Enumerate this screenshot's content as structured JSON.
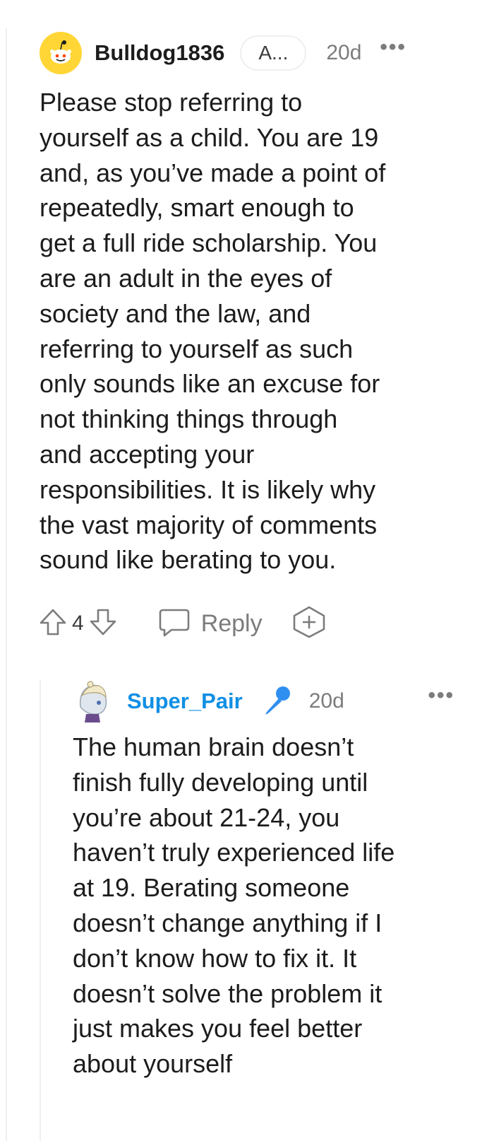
{
  "comment": {
    "author": "Bulldog1836",
    "flair": "A...",
    "age": "20d",
    "more": "•••",
    "body_lines": [
      "Please stop referring to",
      "yourself as a child. You are 19",
      "and, as you’ve made a point of",
      "repeatedly, smart enough to",
      "get a full ride scholarship. You",
      "are an adult in the eyes of",
      "society and the law, and",
      "referring to yourself as such",
      "only sounds like an excuse for",
      "not thinking things through",
      "and accepting your",
      "responsibilities. It is likely why",
      "the vast majority of comments",
      "sound like berating to you."
    ],
    "votes": "4",
    "reply_label": "Reply",
    "icons": {
      "avatar": "snoo-avatar-icon",
      "upvote": "upvote-arrow-icon",
      "downvote": "downvote-arrow-icon",
      "reply": "speech-bubble-icon",
      "award": "award-plus-icon"
    }
  },
  "reply": {
    "author": "Super_Pair",
    "age": "20d",
    "more": "•••",
    "body_lines": [
      "The human brain doesn’t",
      "finish fully developing until",
      "you’re about 21-24, you",
      "haven’t truly experienced life",
      "at 19. Berating someone",
      "doesn’t change anything if I",
      "don’t know how to fix it. It",
      "doesn’t solve the problem it",
      "just makes you feel better",
      "about yourself"
    ],
    "icons": {
      "avatar": "user-avatar-icon",
      "badge": "microphone-icon"
    }
  },
  "colors": {
    "text": "#1c1c1c",
    "meta": "#7c7c7c",
    "username_link": "#0f8fe4",
    "avatar_bg": "#ffd635",
    "rail": "#edeff1"
  }
}
